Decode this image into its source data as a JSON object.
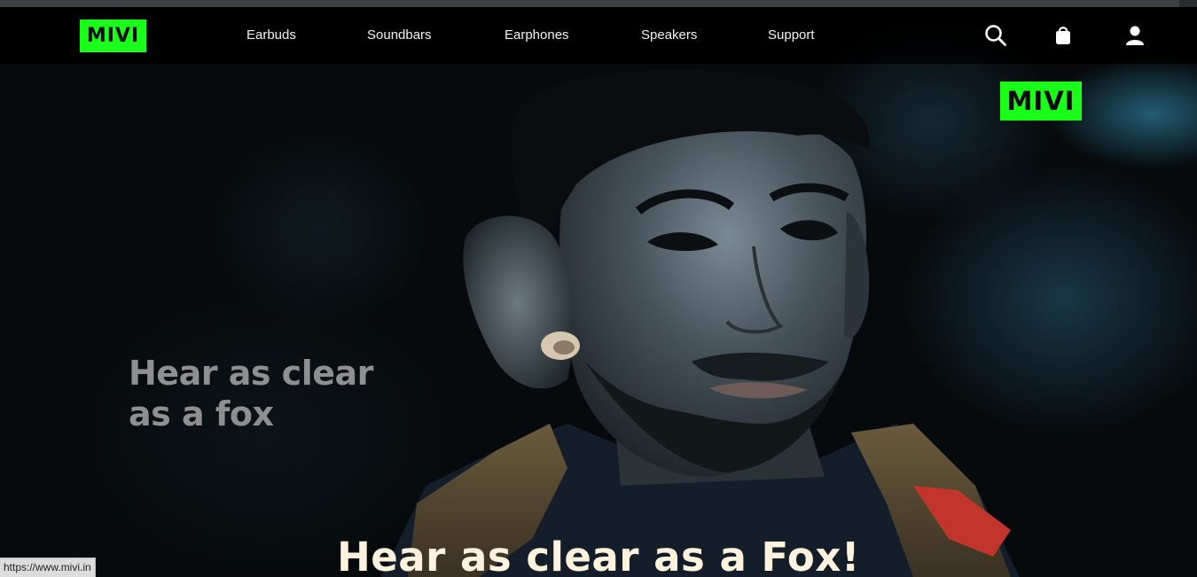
{
  "brand": {
    "logo_text": "MIVI",
    "accent_color": "#1aff1a"
  },
  "nav": {
    "items": [
      {
        "label": "Earbuds"
      },
      {
        "label": "Soundbars"
      },
      {
        "label": "Earphones"
      },
      {
        "label": "Speakers"
      },
      {
        "label": "Support"
      }
    ],
    "icons": [
      "search-icon",
      "shopping-bag-icon",
      "user-icon"
    ]
  },
  "hero": {
    "watermark_text": "MIVI",
    "caption_lines": [
      "Hear as clear",
      "as a fox"
    ],
    "subtitle": "Hear as clear as a Fox!"
  },
  "status_bar": {
    "url": "https://www.mivi.in"
  }
}
